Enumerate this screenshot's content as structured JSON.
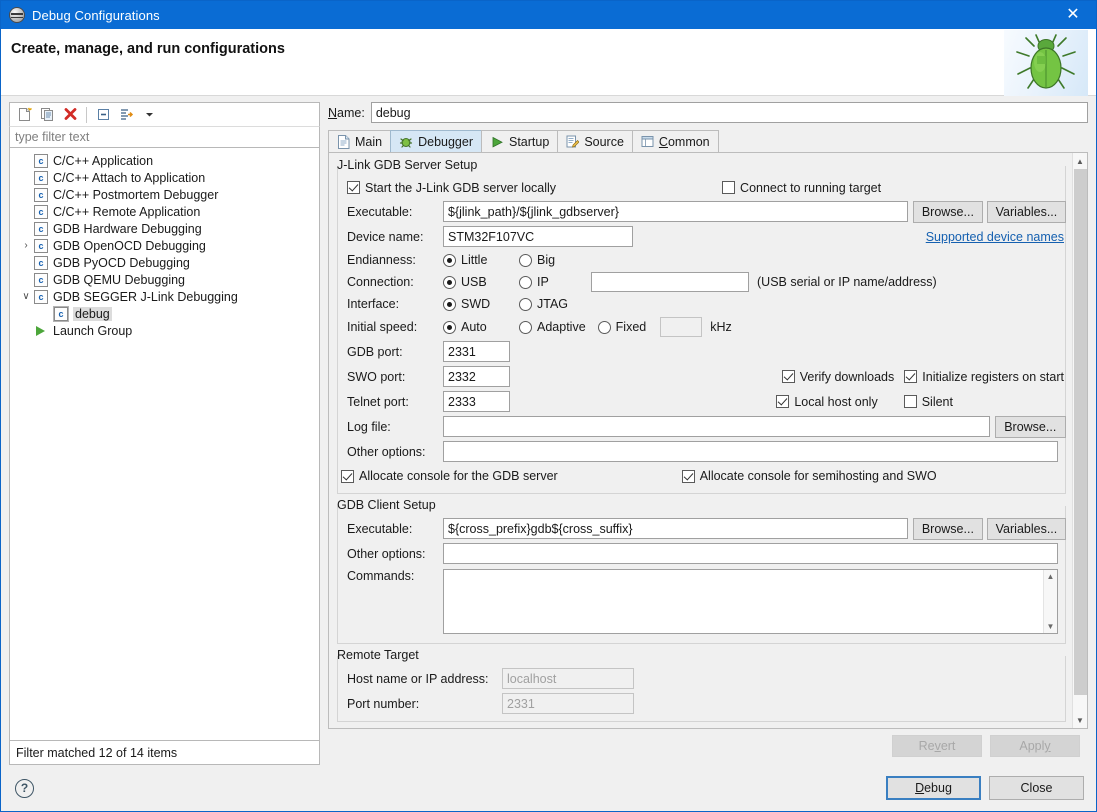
{
  "window": {
    "title": "Debug Configurations",
    "icon": "configurations-icon",
    "close_label": "✕"
  },
  "header": {
    "title": "Create, manage, and run configurations",
    "decoration_icon": "green-bug-icon"
  },
  "tree_toolbar": {
    "buttons": [
      {
        "name": "new-configuration-button",
        "title": "New launch configuration"
      },
      {
        "name": "duplicate-configuration-button",
        "title": "Duplicate"
      },
      {
        "name": "delete-configuration-button",
        "title": "Delete"
      },
      {
        "name": "collapse-all-button",
        "title": "Collapse All"
      },
      {
        "name": "filter-configurations-button",
        "title": "Filter launch configurations"
      },
      {
        "name": "toolbar-dropdown-arrow",
        "title": "Menu"
      }
    ]
  },
  "filter": {
    "placeholder": "type filter text",
    "value": "",
    "status": "Filter matched 12 of 14 items"
  },
  "tree": {
    "items": [
      {
        "label": "C/C++ Application",
        "icon": "c-config-icon",
        "twisty": "",
        "indent": 1,
        "selected": false
      },
      {
        "label": "C/C++ Attach to Application",
        "icon": "c-config-icon",
        "twisty": "",
        "indent": 1,
        "selected": false
      },
      {
        "label": "C/C++ Postmortem Debugger",
        "icon": "c-config-icon",
        "twisty": "",
        "indent": 1,
        "selected": false
      },
      {
        "label": "C/C++ Remote Application",
        "icon": "c-config-icon",
        "twisty": "",
        "indent": 1,
        "selected": false
      },
      {
        "label": "GDB Hardware Debugging",
        "icon": "c-config-icon",
        "twisty": "",
        "indent": 1,
        "selected": false
      },
      {
        "label": "GDB OpenOCD Debugging",
        "icon": "c-config-icon",
        "twisty": "›",
        "indent": 1,
        "selected": false
      },
      {
        "label": "GDB PyOCD Debugging",
        "icon": "c-config-icon",
        "twisty": "",
        "indent": 1,
        "selected": false
      },
      {
        "label": "GDB QEMU Debugging",
        "icon": "c-config-icon",
        "twisty": "",
        "indent": 1,
        "selected": false
      },
      {
        "label": "GDB SEGGER J-Link Debugging",
        "icon": "c-config-icon",
        "twisty": "∨",
        "indent": 1,
        "selected": false
      },
      {
        "label": "debug",
        "icon": "c-config-icon",
        "twisty": "",
        "indent": 2,
        "selected": true
      },
      {
        "label": "Launch Group",
        "icon": "launch-group-icon",
        "twisty": "",
        "indent": 1,
        "selected": false
      }
    ]
  },
  "name_field": {
    "label": "Name:",
    "label_mnemonic": "N",
    "value": "debug"
  },
  "tabs": [
    {
      "label": "Main",
      "icon": "document-icon",
      "active": false
    },
    {
      "label": "Debugger",
      "icon": "debugger-icon",
      "active": true
    },
    {
      "label": "Startup",
      "icon": "startup-play-icon",
      "active": false
    },
    {
      "label": "Source",
      "icon": "source-icon",
      "active": false
    },
    {
      "label": "Common",
      "icon": "common-icon",
      "active": false,
      "mnemonic": "C"
    }
  ],
  "server_group": {
    "title": "J-Link GDB Server Setup",
    "start_server": {
      "label": "Start the J-Link GDB server locally",
      "checked": true
    },
    "connect_running": {
      "label": "Connect to running target",
      "checked": false
    },
    "executable": {
      "label": "Executable:",
      "value": "${jlink_path}/${jlink_gdbserver}",
      "browse_label": "Browse...",
      "variables_label": "Variables..."
    },
    "device_name": {
      "label": "Device name:",
      "value": "STM32F107VC",
      "link_label": "Supported device names"
    },
    "endianness": {
      "label": "Endianness:",
      "options": [
        {
          "label": "Little",
          "selected": true
        },
        {
          "label": "Big",
          "selected": false
        }
      ]
    },
    "connection": {
      "label": "Connection:",
      "options": [
        {
          "label": "USB",
          "selected": true
        },
        {
          "label": "IP",
          "selected": false
        }
      ],
      "address_value": "",
      "hint": "(USB serial or IP name/address)"
    },
    "interface": {
      "label": "Interface:",
      "options": [
        {
          "label": "SWD",
          "selected": true
        },
        {
          "label": "JTAG",
          "selected": false
        }
      ]
    },
    "initial_speed": {
      "label": "Initial speed:",
      "options": [
        {
          "label": "Auto",
          "selected": true
        },
        {
          "label": "Adaptive",
          "selected": false
        },
        {
          "label": "Fixed",
          "selected": false
        }
      ],
      "fixed_value": "",
      "unit": "kHz"
    },
    "gdb_port": {
      "label": "GDB port:",
      "value": "2331"
    },
    "swo_port": {
      "label": "SWO port:",
      "value": "2332"
    },
    "telnet_port": {
      "label": "Telnet port:",
      "value": "2333"
    },
    "verify_downloads": {
      "label": "Verify downloads",
      "checked": true
    },
    "init_registers": {
      "label": "Initialize registers on start",
      "checked": true
    },
    "local_host_only": {
      "label": "Local host only",
      "checked": true
    },
    "silent": {
      "label": "Silent",
      "checked": false
    },
    "log_file": {
      "label": "Log file:",
      "value": "",
      "browse_label": "Browse..."
    },
    "other_options": {
      "label": "Other options:",
      "value": ""
    },
    "alloc_console_server": {
      "label": "Allocate console for the GDB server",
      "checked": true
    },
    "alloc_console_semihosting": {
      "label": "Allocate console for semihosting and SWO",
      "checked": true
    }
  },
  "client_group": {
    "title": "GDB Client Setup",
    "executable": {
      "label": "Executable:",
      "value": "${cross_prefix}gdb${cross_suffix}",
      "browse_label": "Browse...",
      "variables_label": "Variables..."
    },
    "other_options": {
      "label": "Other options:",
      "value": ""
    },
    "commands": {
      "label": "Commands:",
      "value": ""
    }
  },
  "remote_group": {
    "title": "Remote Target",
    "host": {
      "label": "Host name or IP address:",
      "value": "localhost",
      "disabled": true
    },
    "port": {
      "label": "Port number:",
      "value": "2331",
      "disabled": true
    }
  },
  "footer": {
    "revert": {
      "label": "Revert",
      "mnemonic": "v",
      "disabled": true
    },
    "apply": {
      "label": "Apply",
      "mnemonic": "y",
      "disabled": true
    },
    "debug": {
      "label": "Debug",
      "mnemonic": "D",
      "default": true
    },
    "close": {
      "label": "Close"
    },
    "help_icon": "help-question-icon"
  }
}
